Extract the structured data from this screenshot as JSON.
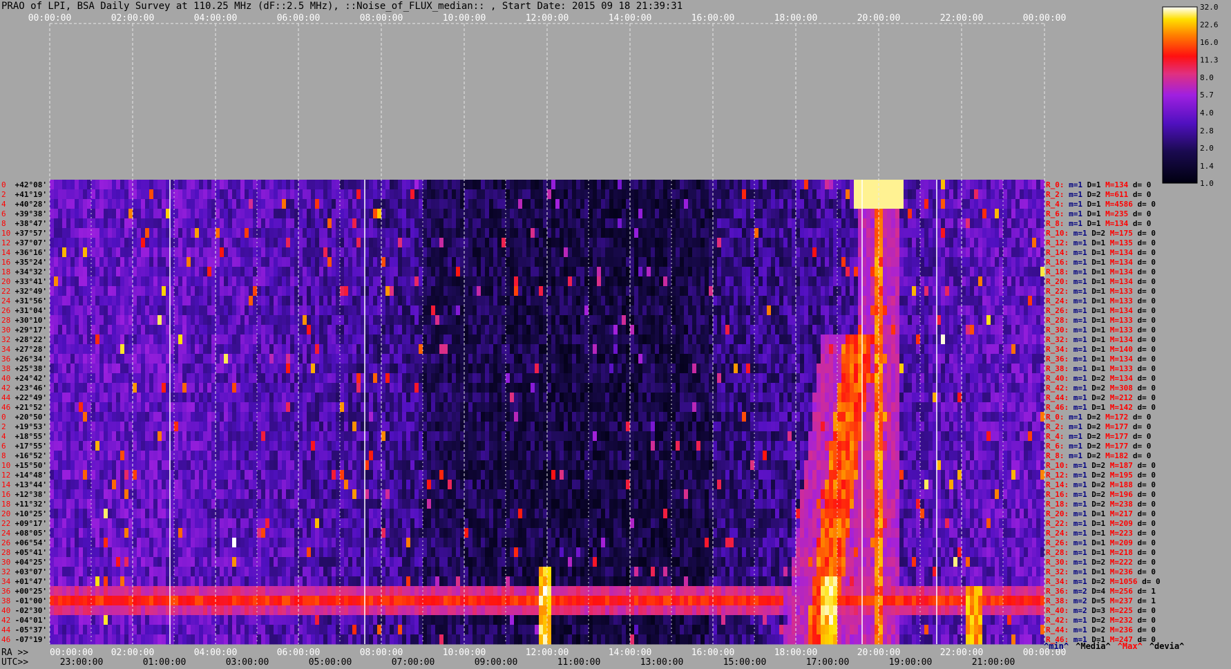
{
  "title": "PRAO of LPI, BSA Daily Survey at 110.25 MHz (dF::2.5 MHz), ::Noise_of_FLUX_median:: , Start Date: 2015 09 18 21:39:31",
  "ra_prefix": "RA >>",
  "utc_prefix": "UTC>>",
  "legend_keys": [
    {
      "text": "^min^",
      "color": "#000080"
    },
    {
      "text": "^Media^",
      "color": "#000000"
    },
    {
      "text": "^Max^",
      "color": "#ff0000"
    },
    {
      "text": "^devia^",
      "color": "#000000"
    }
  ],
  "colors": {
    "background": "#a6a6a6",
    "plot_bg": "#2a0a6a",
    "gridline": "#ffffff",
    "dec_label": "#000000",
    "row_index": "#ff0000",
    "row_m": "#000080",
    "row_D": "#000000",
    "row_M": "#ff0000"
  },
  "chart_data": {
    "type": "heatmap",
    "title": "PRAO of LPI, BSA Daily Survey at 110.25 MHz (dF::2.5 MHz), ::Noise_of_FLUX_median:: , Start Date: 2015 09 18 21:39:31",
    "top_axis_ticks": [
      "00:00:00",
      "02:00:00",
      "04:00:00",
      "06:00:00",
      "08:00:00",
      "10:00:00",
      "12:00:00",
      "14:00:00",
      "16:00:00",
      "18:00:00",
      "20:00:00",
      "22:00:00",
      "00:00:00"
    ],
    "ra_ticks": [
      "00:00:00",
      "02:00:00",
      "04:00:00",
      "06:00:00",
      "08:00:00",
      "10:00:00",
      "12:00:00",
      "14:00:00",
      "16:00:00",
      "18:00:00",
      "20:00:00",
      "22:00:00",
      "00:00:00"
    ],
    "utc_ticks": [
      "23:00:00",
      "01:00:00",
      "03:00:00",
      "05:00:00",
      "07:00:00",
      "09:00:00",
      "11:00:00",
      "13:00:00",
      "15:00:00",
      "17:00:00",
      "19:00:00",
      "21:00:00"
    ],
    "declinations": [
      "+42°08'",
      "+41°19'",
      "+40°28'",
      "+39°38'",
      "+38°47'",
      "+37°57'",
      "+37°07'",
      "+36°16'",
      "+35°24'",
      "+34°32'",
      "+33°41'",
      "+32°49'",
      "+31°56'",
      "+31°04'",
      "+30°10'",
      "+29°17'",
      "+28°22'",
      "+27°28'",
      "+26°34'",
      "+25°38'",
      "+24°42'",
      "+23°46'",
      "+22°49'",
      "+21°52'",
      "+20°50'",
      "+19°53'",
      "+18°55'",
      "+17°55'",
      "+16°52'",
      "+15°50'",
      "+14°48'",
      "+13°44'",
      "+12°38'",
      "+11°32'",
      "+10°25'",
      "+09°17'",
      "+08°05'",
      "+06°54'",
      "+05°41'",
      "+04°25'",
      "+03°07'",
      "+01°47'",
      "+00°25'",
      "-01°00'",
      "-02°30'",
      "-04°01'",
      "-05°37'",
      "-07°19'"
    ],
    "row_indices": [
      "0",
      "2",
      "4",
      "6",
      "8",
      "10",
      "12",
      "14",
      "16",
      "18",
      "20",
      "22",
      "24",
      "26",
      "28",
      "30",
      "32",
      "34",
      "36",
      "38",
      "40",
      "42",
      "44",
      "46",
      "0",
      "2",
      "4",
      "6",
      "8",
      "10",
      "12",
      "14",
      "16",
      "18",
      "20",
      "22",
      "24",
      "26",
      "28",
      "30",
      "32",
      "34",
      "36",
      "38",
      "40",
      "42",
      "44",
      "46"
    ],
    "row_stats": [
      {
        "r": "R_0:",
        "m": "m=1",
        "D": "D=1",
        "M": "M=134",
        "d": "d= 0"
      },
      {
        "r": "R_2:",
        "m": "m=1",
        "D": "D=2",
        "M": "M=611",
        "d": "d= 0"
      },
      {
        "r": "R_4:",
        "m": "m=1",
        "D": "D=1",
        "M": "M=4586",
        "d": "d= 0"
      },
      {
        "r": "R_6:",
        "m": "m=1",
        "D": "D=1",
        "M": "M=235",
        "d": "d= 0"
      },
      {
        "r": "R_8:",
        "m": "m=1",
        "D": "D=1",
        "M": "M=134",
        "d": "d= 0"
      },
      {
        "r": "R_10:",
        "m": "m=1",
        "D": "D=2",
        "M": "M=175",
        "d": "d= 0"
      },
      {
        "r": "R_12:",
        "m": "m=1",
        "D": "D=1",
        "M": "M=135",
        "d": "d= 0"
      },
      {
        "r": "R_14:",
        "m": "m=1",
        "D": "D=1",
        "M": "M=134",
        "d": "d= 0"
      },
      {
        "r": "R_16:",
        "m": "m=1",
        "D": "D=1",
        "M": "M=134",
        "d": "d= 0"
      },
      {
        "r": "R_18:",
        "m": "m=1",
        "D": "D=1",
        "M": "M=134",
        "d": "d= 0"
      },
      {
        "r": "R_20:",
        "m": "m=1",
        "D": "D=1",
        "M": "M=134",
        "d": "d= 0"
      },
      {
        "r": "R_22:",
        "m": "m=1",
        "D": "D=1",
        "M": "M=133",
        "d": "d= 0"
      },
      {
        "r": "R_24:",
        "m": "m=1",
        "D": "D=1",
        "M": "M=133",
        "d": "d= 0"
      },
      {
        "r": "R_26:",
        "m": "m=1",
        "D": "D=1",
        "M": "M=134",
        "d": "d= 0"
      },
      {
        "r": "R_28:",
        "m": "m=1",
        "D": "D=1",
        "M": "M=133",
        "d": "d= 0"
      },
      {
        "r": "R_30:",
        "m": "m=1",
        "D": "D=1",
        "M": "M=133",
        "d": "d= 0"
      },
      {
        "r": "R_32:",
        "m": "m=1",
        "D": "D=1",
        "M": "M=134",
        "d": "d= 0"
      },
      {
        "r": "R_34:",
        "m": "m=1",
        "D": "D=1",
        "M": "M=140",
        "d": "d= 0"
      },
      {
        "r": "R_36:",
        "m": "m=1",
        "D": "D=1",
        "M": "M=134",
        "d": "d= 0"
      },
      {
        "r": "R_38:",
        "m": "m=1",
        "D": "D=1",
        "M": "M=133",
        "d": "d= 0"
      },
      {
        "r": "R_40:",
        "m": "m=1",
        "D": "D=2",
        "M": "M=134",
        "d": "d= 0"
      },
      {
        "r": "R_42:",
        "m": "m=1",
        "D": "D=2",
        "M": "M=308",
        "d": "d= 0"
      },
      {
        "r": "R_44:",
        "m": "m=1",
        "D": "D=2",
        "M": "M=212",
        "d": "d= 0"
      },
      {
        "r": "R_46:",
        "m": "m=1",
        "D": "D=1",
        "M": "M=142",
        "d": "d= 0"
      },
      {
        "r": "R_0:",
        "m": "m=1",
        "D": "D=2",
        "M": "M=172",
        "d": "d= 0"
      },
      {
        "r": "R_2:",
        "m": "m=1",
        "D": "D=2",
        "M": "M=177",
        "d": "d= 0"
      },
      {
        "r": "R_4:",
        "m": "m=1",
        "D": "D=2",
        "M": "M=177",
        "d": "d= 0"
      },
      {
        "r": "R_6:",
        "m": "m=1",
        "D": "D=2",
        "M": "M=177",
        "d": "d= 0"
      },
      {
        "r": "R_8:",
        "m": "m=1",
        "D": "D=2",
        "M": "M=182",
        "d": "d= 0"
      },
      {
        "r": "R_10:",
        "m": "m=1",
        "D": "D=2",
        "M": "M=187",
        "d": "d= 0"
      },
      {
        "r": "R_12:",
        "m": "m=1",
        "D": "D=2",
        "M": "M=195",
        "d": "d= 0"
      },
      {
        "r": "R_14:",
        "m": "m=1",
        "D": "D=2",
        "M": "M=188",
        "d": "d= 0"
      },
      {
        "r": "R_16:",
        "m": "m=1",
        "D": "D=2",
        "M": "M=196",
        "d": "d= 0"
      },
      {
        "r": "R_18:",
        "m": "m=1",
        "D": "D=2",
        "M": "M=238",
        "d": "d= 0"
      },
      {
        "r": "R_20:",
        "m": "m=1",
        "D": "D=1",
        "M": "M=217",
        "d": "d= 0"
      },
      {
        "r": "R_22:",
        "m": "m=1",
        "D": "D=1",
        "M": "M=209",
        "d": "d= 0"
      },
      {
        "r": "R_24:",
        "m": "m=1",
        "D": "D=1",
        "M": "M=223",
        "d": "d= 0"
      },
      {
        "r": "R_26:",
        "m": "m=1",
        "D": "D=1",
        "M": "M=209",
        "d": "d= 0"
      },
      {
        "r": "R_28:",
        "m": "m=1",
        "D": "D=1",
        "M": "M=218",
        "d": "d= 0"
      },
      {
        "r": "R_30:",
        "m": "m=1",
        "D": "D=2",
        "M": "M=222",
        "d": "d= 0"
      },
      {
        "r": "R_32:",
        "m": "m=1",
        "D": "D=1",
        "M": "M=236",
        "d": "d= 0"
      },
      {
        "r": "R_34:",
        "m": "m=1",
        "D": "D=2",
        "M": "M=1056",
        "d": "d= 0"
      },
      {
        "r": "R_36:",
        "m": "m=2",
        "D": "D=4",
        "M": "M=256",
        "d": "d= 1"
      },
      {
        "r": "R_38:",
        "m": "m=2",
        "D": "D=5",
        "M": "M=237",
        "d": "d= 1"
      },
      {
        "r": "R_40:",
        "m": "m=2",
        "D": "D=3",
        "M": "M=225",
        "d": "d= 0"
      },
      {
        "r": "R_42:",
        "m": "m=1",
        "D": "D=2",
        "M": "M=232",
        "d": "d= 0"
      },
      {
        "r": "R_44:",
        "m": "m=1",
        "D": "D=2",
        "M": "M=236",
        "d": "d= 0"
      },
      {
        "r": "R_46:",
        "m": "m=1",
        "D": "D=1",
        "M": "M=247",
        "d": "d= 0"
      }
    ],
    "colorbar_ticks": [
      "32.0",
      "22.6",
      "16.0",
      "11.3",
      "8.0",
      "5.7",
      "4.0",
      "2.8",
      "2.0",
      "1.4",
      "1.0"
    ],
    "colorbar_range": [
      1.0,
      32.0
    ],
    "colorbar_scale": "log",
    "features": {
      "bright_source_ra_hours": 20.0,
      "bright_source_dec": "+41°19'",
      "horizontal_band_decs": [
        "+00°25'",
        "-01°00'",
        "-02°30'"
      ],
      "diagonal_streak_ra_range_hours": [
        18.6,
        20.0
      ]
    }
  }
}
